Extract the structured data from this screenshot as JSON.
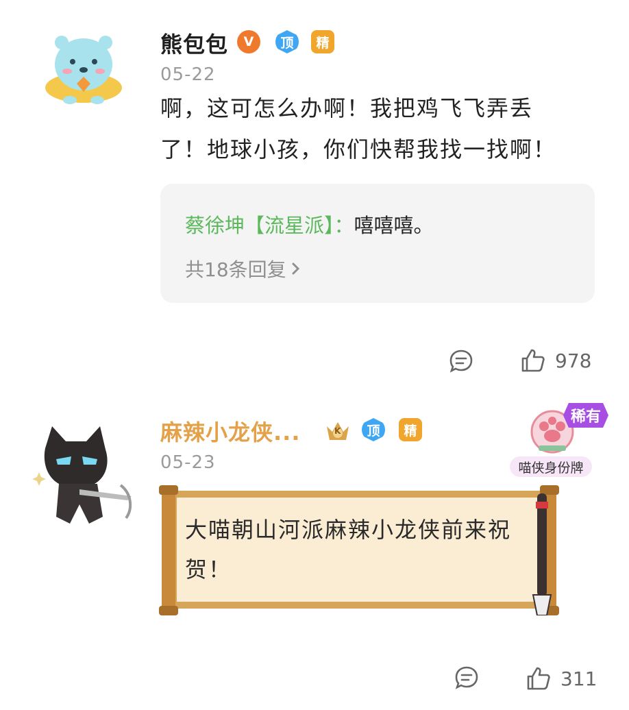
{
  "comments": [
    {
      "author": "熊包包",
      "badges": {
        "v": "V",
        "top": "顶",
        "jing": "精"
      },
      "date": "05-22",
      "text_line1": "啊，这可怎么办啊！我把鸡飞飞弄丢",
      "text_line2": "了！地球小孩，你们快帮我找一找啊！",
      "reply": {
        "author": "蔡徐坤【流星派】：",
        "text": "嘻嘻嘻。",
        "more": "共18条回复"
      },
      "likes": "978"
    },
    {
      "author": "麻辣小龙侠...",
      "badges": {
        "k": "K",
        "top": "顶",
        "jing": "精"
      },
      "date": "05-23",
      "scroll_line1": "大喵朝山河派麻辣小龙侠前来祝",
      "scroll_line2": "贺！",
      "rare_tag": "稀有",
      "id_label": "喵侠身份牌",
      "likes": "311"
    }
  ],
  "colors": {
    "accent_green": "#5cb85c",
    "name_gold": "#e3a24a",
    "rare_purple": "#a84fe3"
  }
}
